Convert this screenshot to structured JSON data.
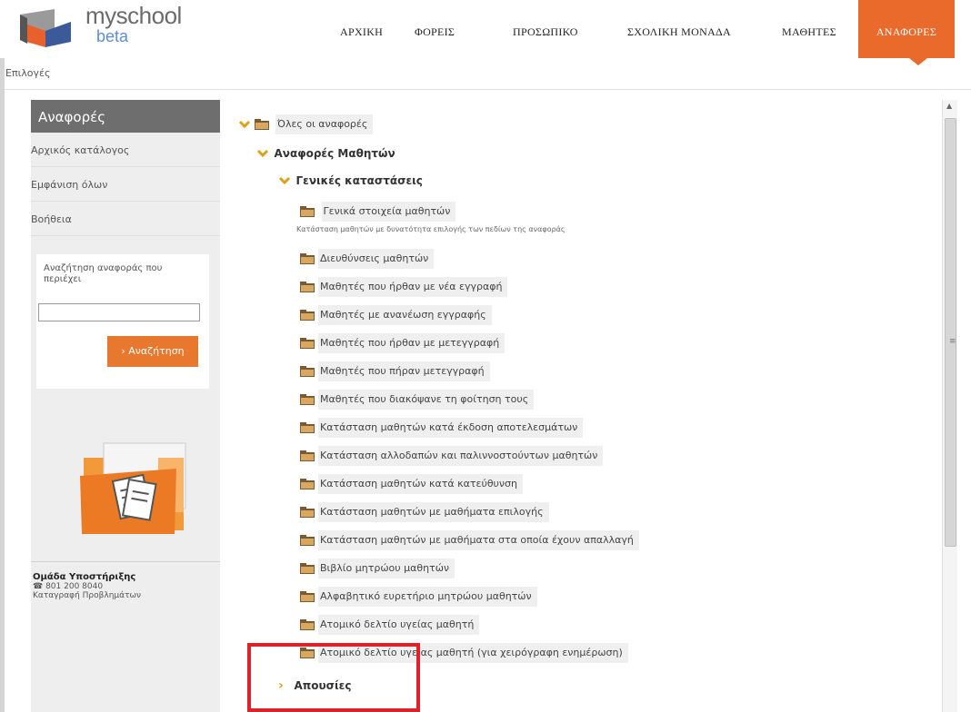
{
  "header": {
    "brand": "myschool",
    "beta": "beta",
    "nav": [
      {
        "label": "ΑΡΧΙΚΗ",
        "active": false
      },
      {
        "label": "ΦΟΡΕΙΣ",
        "active": false
      },
      {
        "label": "ΠΡΟΣΩΠΙΚΟ",
        "active": false
      },
      {
        "label": "ΣΧΟΛΙΚΗ ΜΟΝΑΔΑ",
        "active": false
      },
      {
        "label": "ΜΑΘΗΤΕΣ",
        "active": false
      },
      {
        "label": "ΑΝΑΦΟΡΕΣ",
        "active": true
      }
    ],
    "accent": "#ea6a2c"
  },
  "subbar": {
    "label": "Επιλογές"
  },
  "sidebar": {
    "title": "Αναφορές",
    "links": [
      "Αρχικός κατάλογος",
      "Εμφάνιση όλων",
      "Βοήθεια"
    ],
    "search": {
      "label": "Αναζήτηση αναφοράς που περιέχει",
      "value": "",
      "button": "› Αναζήτηση"
    },
    "support": {
      "title": "Ομάδα Υποστήριξης",
      "phone": "801 200 8040",
      "report": "Καταγραφή Προβλημάτων"
    }
  },
  "tree": {
    "root": "Όλες οι αναφορές",
    "group": "Αναφορές Μαθητών",
    "subgroup": "Γενικές καταστάσεις",
    "first_item": "Γενικά στοιχεία μαθητών",
    "first_desc": "Κατάσταση μαθητών με δυνατότητα επιλογής των πεδίων της αναφοράς",
    "items": [
      "Διευθύνσεις μαθητών",
      "Μαθητές που ήρθαν με νέα εγγραφή",
      "Μαθητές με ανανέωση εγγραφής",
      "Μαθητές που ήρθαν με μετεγγραφή",
      "Μαθητές που πήραν μετεγγραφή",
      "Μαθητές που διακόψανε τη φοίτηση τους",
      "Κατάσταση μαθητών κατά έκδοση αποτελεσμάτων",
      "Κατάσταση αλλοδαπών και παλιννοστούντων μαθητών",
      "Κατάσταση μαθητών κατά κατεύθυνση",
      "Κατάσταση μαθητών με μαθήματα επιλογής",
      "Κατάσταση μαθητών με μαθήματα στα οποία έχουν απαλλαγή",
      "Βιβλίο μητρώου μαθητών",
      "Αλφαβητικό ευρετήριο μητρώου μαθητών",
      "Ατομικό δελτίο υγείας μαθητή",
      "Ατομικό δελτίο υγείας μαθητή (για χειρόγραφη ενημέρωση)"
    ],
    "collapsed_group": "Απουσίες"
  }
}
